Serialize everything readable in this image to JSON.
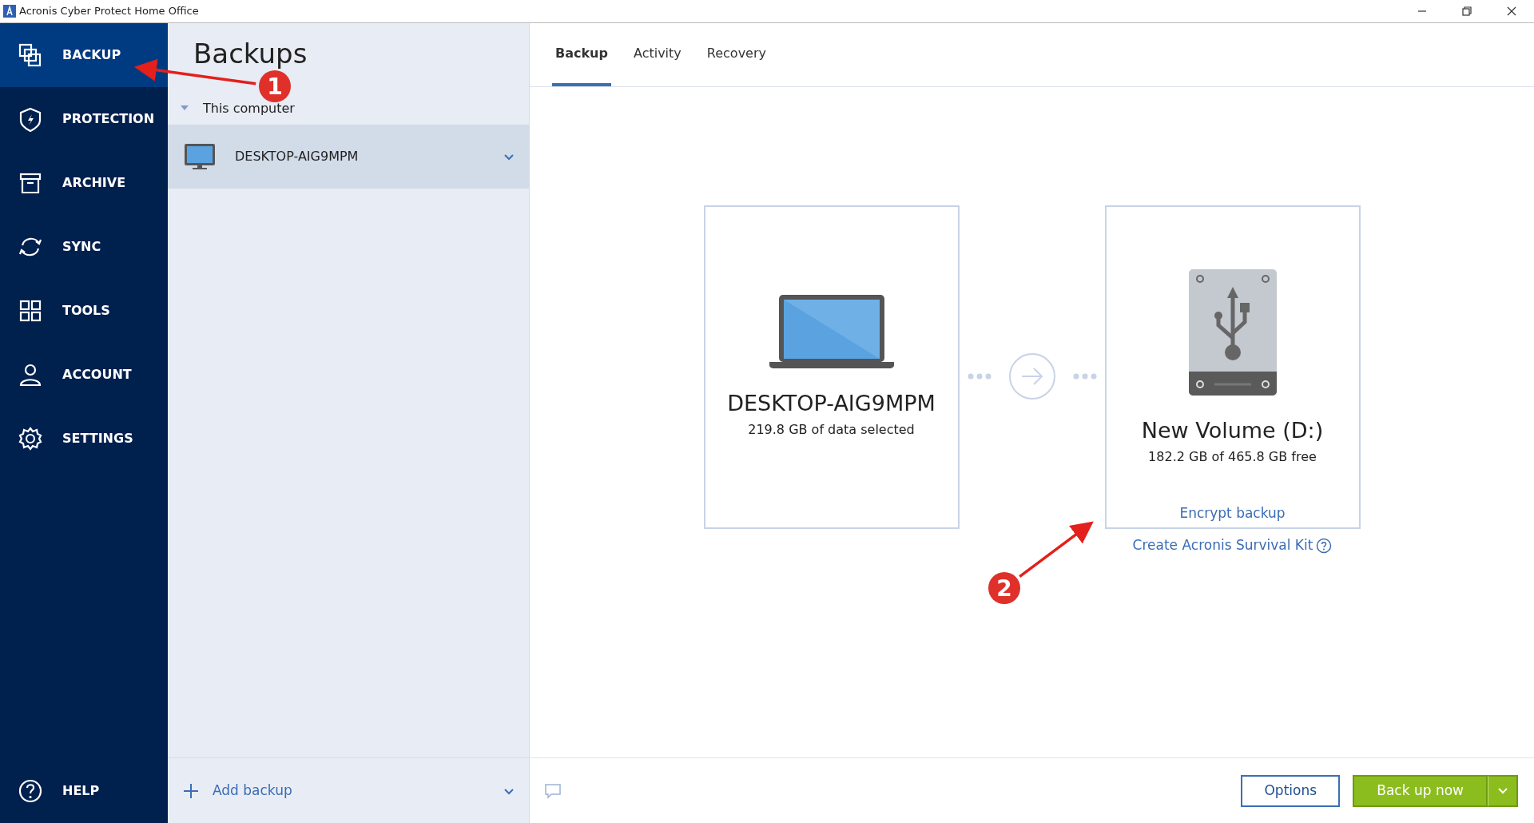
{
  "window": {
    "title": "Acronis Cyber Protect Home Office"
  },
  "sidebar": {
    "items": [
      {
        "label": "BACKUP",
        "selected": true
      },
      {
        "label": "PROTECTION",
        "selected": false
      },
      {
        "label": "ARCHIVE",
        "selected": false
      },
      {
        "label": "SYNC",
        "selected": false
      },
      {
        "label": "TOOLS",
        "selected": false
      },
      {
        "label": "ACCOUNT",
        "selected": false
      },
      {
        "label": "SETTINGS",
        "selected": false
      }
    ],
    "help": "HELP"
  },
  "backups_panel": {
    "title": "Backups",
    "group": {
      "label": "This computer",
      "expanded": true
    },
    "items": [
      {
        "name": "DESKTOP-AIG9MPM",
        "selected": true
      }
    ],
    "add_backup": "Add backup"
  },
  "tabs": [
    {
      "label": "Backup",
      "selected": true
    },
    {
      "label": "Activity",
      "selected": false
    },
    {
      "label": "Recovery",
      "selected": false
    }
  ],
  "source": {
    "name": "DESKTOP-AIG9MPM",
    "detail": "219.8 GB of data selected"
  },
  "destination": {
    "name": "New Volume (D:)",
    "detail": "182.2 GB of 465.8 GB free",
    "link": "Encrypt backup"
  },
  "survival_kit_link": "Create Acronis Survival Kit",
  "buttons": {
    "options": "Options",
    "back_up_now": "Back up now"
  },
  "annotations": [
    {
      "label": "1"
    },
    {
      "label": "2"
    }
  ]
}
